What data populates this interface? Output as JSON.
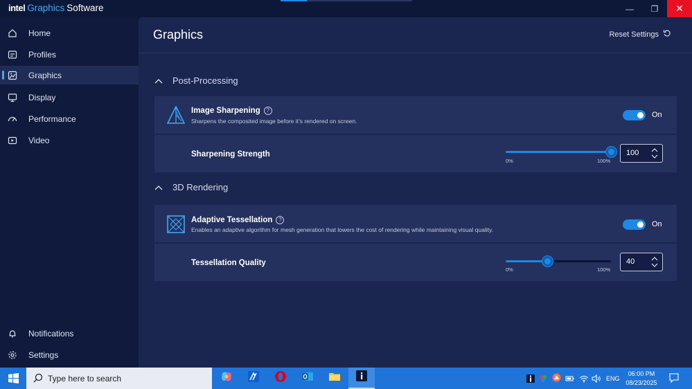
{
  "app": {
    "brand_intel": "intel",
    "brand_graphics": "Graphics",
    "brand_software": "Software"
  },
  "window_controls": {
    "minimize": "—",
    "maximize": "❐",
    "close": "✕"
  },
  "sidebar": {
    "items": [
      {
        "label": "Home",
        "icon": "home-icon"
      },
      {
        "label": "Profiles",
        "icon": "profiles-icon"
      },
      {
        "label": "Graphics",
        "icon": "graphics-icon",
        "active": true
      },
      {
        "label": "Display",
        "icon": "display-icon"
      },
      {
        "label": "Performance",
        "icon": "performance-icon"
      },
      {
        "label": "Video",
        "icon": "video-icon"
      }
    ],
    "bottom_items": [
      {
        "label": "Notifications",
        "icon": "bell-icon"
      },
      {
        "label": "Settings",
        "icon": "gear-icon"
      }
    ]
  },
  "main": {
    "title": "Graphics",
    "reset_label": "Reset Settings",
    "sections": [
      {
        "title": "Post-Processing",
        "feature": {
          "title": "Image Sharpening",
          "description": "Sharpens the composited image before it’s rendered on screen.",
          "toggle_label": "On",
          "enabled": true
        },
        "setting": {
          "label": "Sharpening Strength",
          "value": "100",
          "fraction": 1.0,
          "min_label": "0%",
          "max_label": "100%"
        }
      },
      {
        "title": "3D Rendering",
        "feature": {
          "title": "Adaptive Tessellation",
          "description": "Enables an adaptive algorithm for mesh generation that lowers the cost of rendering while maintaining visual quality.",
          "toggle_label": "On",
          "enabled": true
        },
        "setting": {
          "label": "Tessellation Quality",
          "value": "40",
          "fraction": 0.4,
          "min_label": "0%",
          "max_label": "100%"
        }
      }
    ]
  },
  "taskbar": {
    "search_placeholder": "Type here to search",
    "language": "ENG",
    "time": "06:00 PM",
    "date": "08/23/2025"
  },
  "colors": {
    "accent": "#1e88e5",
    "background": "#0f1a3c",
    "panel": "#1a2650",
    "card": "#24315e",
    "close_button": "#e81123",
    "taskbar": "#1f74d9"
  }
}
